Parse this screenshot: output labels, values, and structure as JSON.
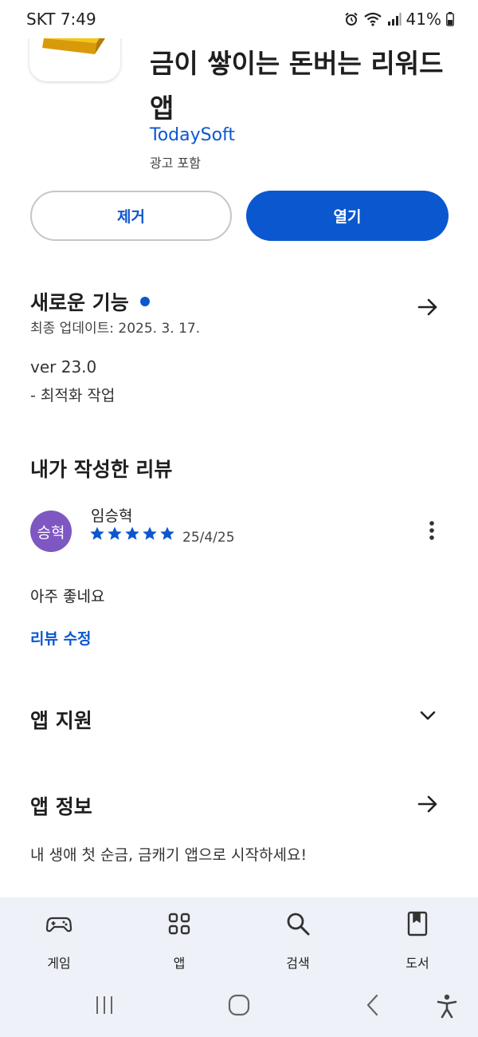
{
  "status_bar": {
    "carrier_time": "SKT 7:49",
    "battery": "41%"
  },
  "app": {
    "title": "금이 쌓이는 돈버는 리워드 앱",
    "developer": "TodaySoft",
    "ads_notice": "광고 포함",
    "icon": "gold-bars-icon"
  },
  "actions": {
    "remove_label": "제거",
    "open_label": "열기"
  },
  "whats_new": {
    "title": "새로운 기능",
    "updated": "최종 업데이트: 2025. 3. 17.",
    "version": "ver 23.0",
    "notes": "- 최적화 작업"
  },
  "my_review": {
    "title": "내가 작성한 리뷰",
    "avatar_text": "승혁",
    "reviewer": "임승혁",
    "rating": 5,
    "date": "25/4/25",
    "text": "아주 좋네요",
    "edit_label": "리뷰 수정"
  },
  "app_support": {
    "title": "앱 지원"
  },
  "app_info": {
    "title": "앱 정보",
    "description": "내 생애 첫 순금, 금캐기 앱으로 시작하세요!"
  },
  "bottom_nav": [
    {
      "label": "게임",
      "icon": "gamepad-icon"
    },
    {
      "label": "앱",
      "icon": "apps-grid-icon"
    },
    {
      "label": "검색",
      "icon": "search-icon"
    },
    {
      "label": "도서",
      "icon": "book-icon"
    }
  ],
  "colors": {
    "accent": "#0b57d0",
    "avatar": "#7e57c2",
    "nav_bg": "#eef1f7"
  }
}
